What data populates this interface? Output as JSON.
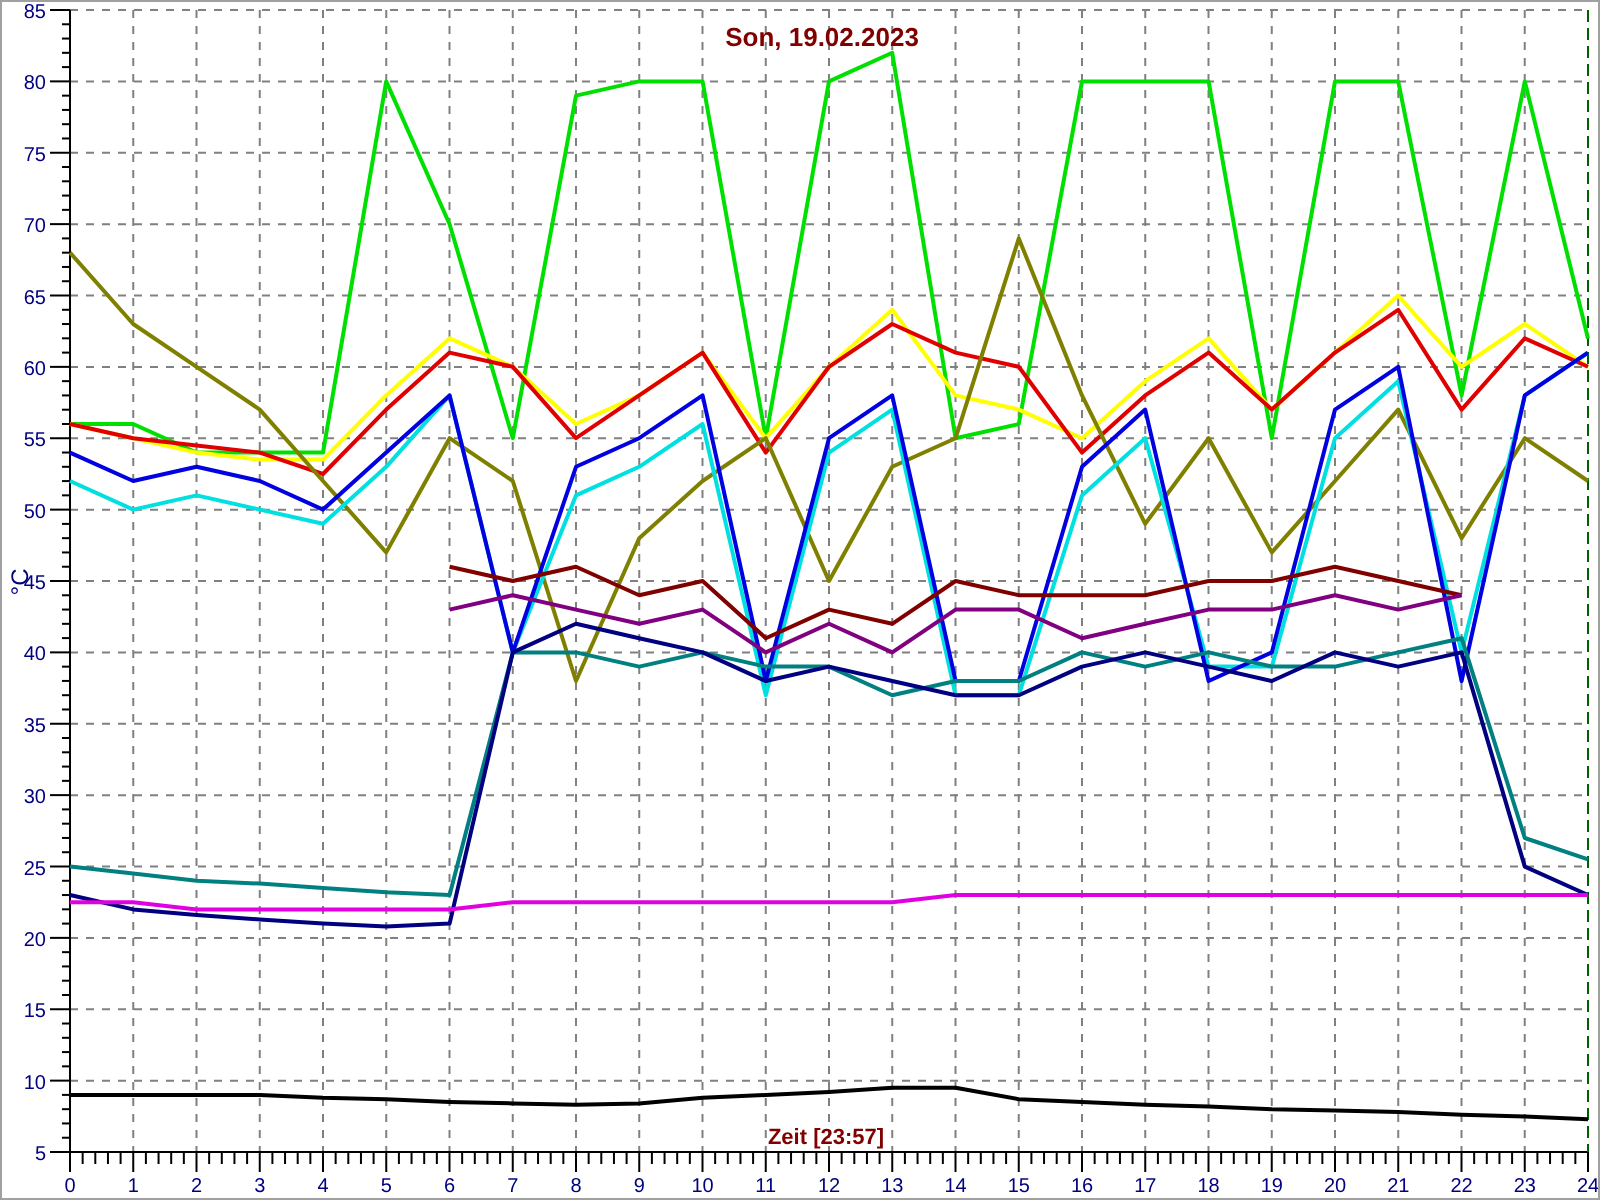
{
  "chart": {
    "chart_data": {
      "type": "line",
      "title": "Son, 19.02.2023",
      "xlabel": "Zeit [23:57]",
      "ylabel": "°C",
      "x": [
        0,
        1,
        2,
        3,
        4,
        5,
        6,
        7,
        8,
        9,
        10,
        11,
        12,
        13,
        14,
        15,
        16,
        17,
        18,
        19,
        20,
        21,
        22,
        23,
        24
      ],
      "xlim": [
        0,
        24
      ],
      "ylim": [
        5,
        85
      ],
      "grid": true,
      "xticks": [
        0,
        1,
        2,
        3,
        4,
        5,
        6,
        7,
        8,
        9,
        10,
        11,
        12,
        13,
        14,
        15,
        16,
        17,
        18,
        19,
        20,
        21,
        22,
        23,
        24
      ],
      "yticks": [
        5,
        10,
        15,
        20,
        25,
        30,
        35,
        40,
        45,
        50,
        55,
        60,
        65,
        70,
        75,
        80,
        85
      ],
      "series": [
        {
          "color": "#00e000",
          "values": [
            56,
            56,
            54,
            54,
            54,
            80,
            70,
            55,
            79,
            80,
            80,
            55,
            80,
            82,
            55,
            56,
            80,
            80,
            80,
            55,
            80,
            80,
            58,
            80,
            62
          ]
        },
        {
          "color": "#ffff00",
          "values": [
            56,
            55,
            54,
            53.5,
            53.5,
            58,
            62,
            60,
            56,
            58,
            61,
            55,
            60,
            64,
            58,
            57,
            55,
            59,
            62,
            57,
            61,
            65,
            60,
            63,
            60
          ]
        },
        {
          "color": "#e00000",
          "values": [
            56,
            55,
            54.5,
            54,
            52.5,
            57,
            61,
            60,
            55,
            58,
            61,
            54,
            60,
            63,
            61,
            60,
            54,
            58,
            61,
            57,
            61,
            64,
            57,
            62,
            60
          ]
        },
        {
          "color": "#808000",
          "values": [
            68,
            63,
            60,
            57,
            52,
            47,
            55,
            52,
            38,
            48,
            52,
            55,
            45,
            53,
            55,
            69,
            58,
            49,
            55,
            47,
            52,
            57,
            48,
            55,
            52
          ]
        },
        {
          "color": "#00e0e0",
          "values": [
            52,
            50,
            51,
            50,
            49,
            53,
            58,
            40,
            51,
            53,
            56,
            37,
            54,
            57,
            37,
            37,
            51,
            55,
            39,
            39,
            55,
            59,
            40,
            58,
            61
          ]
        },
        {
          "color": "#0000e0",
          "values": [
            54,
            52,
            53,
            52,
            50,
            54,
            58,
            40,
            53,
            55,
            58,
            38,
            55,
            58,
            38,
            38,
            53,
            57,
            38,
            40,
            57,
            60,
            38,
            58,
            61
          ]
        },
        {
          "color": "#800000",
          "values": [
            null,
            null,
            null,
            null,
            null,
            null,
            46,
            45,
            46,
            44,
            45,
            41,
            43,
            42,
            45,
            44,
            44,
            44,
            45,
            45,
            46,
            45,
            44,
            null,
            null
          ]
        },
        {
          "color": "#800080",
          "values": [
            null,
            null,
            null,
            null,
            null,
            null,
            43,
            44,
            43,
            42,
            43,
            40,
            42,
            40,
            43,
            43,
            41,
            42,
            43,
            43,
            44,
            43,
            44,
            null,
            null
          ]
        },
        {
          "color": "#008080",
          "values": [
            25,
            24.5,
            24,
            23.8,
            23.5,
            23.2,
            23,
            40,
            40,
            39,
            40,
            39,
            39,
            37,
            38,
            38,
            40,
            39,
            40,
            39,
            39,
            40,
            41,
            27,
            25.5
          ]
        },
        {
          "color": "#000080",
          "values": [
            23,
            22,
            21.6,
            21.3,
            21,
            20.8,
            21,
            40,
            42,
            41,
            40,
            38,
            39,
            38,
            37,
            37,
            39,
            40,
            39,
            38,
            40,
            39,
            40,
            25,
            23
          ]
        },
        {
          "color": "#e000e0",
          "values": [
            22.5,
            22.5,
            22,
            22,
            22,
            22,
            22,
            22.5,
            22.5,
            22.5,
            22.5,
            22.5,
            22.5,
            22.5,
            23,
            23,
            23,
            23,
            23,
            23,
            23,
            23,
            23,
            23,
            23
          ]
        },
        {
          "color": "#000000",
          "values": [
            9,
            9,
            9,
            9,
            8.8,
            8.7,
            8.5,
            8.4,
            8.3,
            8.4,
            8.8,
            9,
            9.2,
            9.5,
            9.5,
            8.7,
            8.5,
            8.3,
            8.2,
            8,
            7.9,
            7.8,
            7.6,
            7.5,
            7.3
          ]
        }
      ]
    }
  }
}
